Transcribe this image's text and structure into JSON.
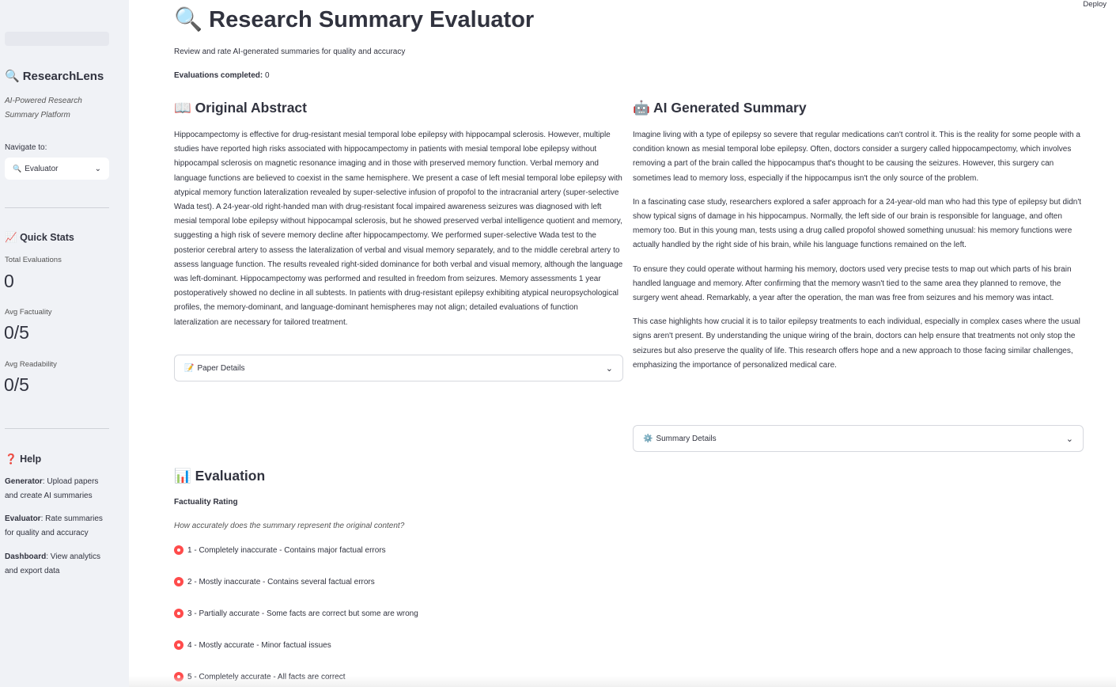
{
  "topbar": {
    "deploy_label": "Deploy"
  },
  "sidebar": {
    "brand_icon": "🔍",
    "brand": "ResearchLens",
    "tagline": "AI-Powered Research Summary Platform",
    "nav_label": "Navigate to:",
    "nav_selected_icon": "🔍",
    "nav_selected": "Evaluator",
    "quick_stats_icon": "📈",
    "quick_stats_title": "Quick Stats",
    "stats": [
      {
        "label": "Total Evaluations",
        "value": "0"
      },
      {
        "label": "Avg Factuality",
        "value": "0/5"
      },
      {
        "label": "Avg Readability",
        "value": "0/5"
      }
    ],
    "help_icon": "❓",
    "help_title": "Help",
    "help_items": [
      {
        "term": "Generator",
        "text": ": Upload papers and create AI summaries"
      },
      {
        "term": "Evaluator",
        "text": ": Rate summaries for quality and accuracy"
      },
      {
        "term": "Dashboard",
        "text": ": View analytics and export data"
      }
    ]
  },
  "main": {
    "title_icon": "🔍",
    "title": "Research Summary Evaluator",
    "subtitle": "Review and rate AI-generated summaries for quality and accuracy",
    "evaluations_label": "Evaluations completed:",
    "evaluations_value": "0",
    "abstract_icon": "📖",
    "abstract_title": "Original Abstract",
    "abstract_text": "Hippocampectomy is effective for drug-resistant mesial temporal lobe epilepsy with hippocampal sclerosis. However, multiple studies have reported high risks associated with hippocampectomy in patients with mesial temporal lobe epilepsy without hippocampal sclerosis on magnetic resonance imaging and in those with preserved memory function. Verbal memory and language functions are believed to coexist in the same hemisphere. We present a case of left mesial temporal lobe epilepsy with atypical memory function lateralization revealed by super-selective infusion of propofol to the intracranial artery (super-selective Wada test). A 24-year-old right-handed man with drug-resistant focal impaired awareness seizures was diagnosed with left mesial temporal lobe epilepsy without hippocampal sclerosis, but he showed preserved verbal intelligence quotient and memory, suggesting a high risk of severe memory decline after hippocampectomy. We performed super-selective Wada test to the posterior cerebral artery to assess the lateralization of verbal and visual memory separately, and to the middle cerebral artery to assess language function. The results revealed right-sided dominance for both verbal and visual memory, although the language was left-dominant. Hippocampectomy was performed and resulted in freedom from seizures. Memory assessments 1 year postoperatively showed no decline in all subtests. In patients with drug-resistant epilepsy exhibiting atypical neuropsychological profiles, the memory-dominant, and language-dominant hemispheres may not align; detailed evaluations of function lateralization are necessary for tailored treatment.",
    "paper_details_icon": "📝",
    "paper_details_label": "Paper Details",
    "summary_icon": "🤖",
    "summary_title": "AI Generated Summary",
    "summary_paragraphs": [
      "Imagine living with a type of epilepsy so severe that regular medications can't control it. This is the reality for some people with a condition known as mesial temporal lobe epilepsy. Often, doctors consider a surgery called hippocampectomy, which involves removing a part of the brain called the hippocampus that's thought to be causing the seizures. However, this surgery can sometimes lead to memory loss, especially if the hippocampus isn't the only source of the problem.",
      "In a fascinating case study, researchers explored a safer approach for a 24-year-old man who had this type of epilepsy but didn't show typical signs of damage in his hippocampus. Normally, the left side of our brain is responsible for language, and often memory too. But in this young man, tests using a drug called propofol showed something unusual: his memory functions were actually handled by the right side of his brain, while his language functions remained on the left.",
      "To ensure they could operate without harming his memory, doctors used very precise tests to map out which parts of his brain handled language and memory. After confirming that the memory wasn't tied to the same area they planned to remove, the surgery went ahead. Remarkably, a year after the operation, the man was free from seizures and his memory was intact.",
      "This case highlights how crucial it is to tailor epilepsy treatments to each individual, especially in complex cases where the usual signs aren't present. By understanding the unique wiring of the brain, doctors can help ensure that treatments not only stop the seizures but also preserve the quality of life. This research offers hope and a new approach to those facing similar challenges, emphasizing the importance of personalized medical care."
    ],
    "summary_details_icon": "⚙️",
    "summary_details_label": "Summary Details",
    "evaluation_icon": "📊",
    "evaluation_title": "Evaluation",
    "factuality_label": "Factuality Rating",
    "factuality_help": "How accurately does the summary represent the original content?",
    "factuality_options": [
      "1 - Completely inaccurate - Contains major factual errors",
      "2 - Mostly inaccurate - Contains several factual errors",
      "3 - Partially accurate - Some facts are correct but some are wrong",
      "4 - Mostly accurate - Minor factual issues",
      "5 - Completely accurate - All facts are correct"
    ]
  },
  "colors": {
    "accent": "#ff4b4b",
    "sidebar_bg": "#f0f2f6",
    "text": "#31333f"
  }
}
